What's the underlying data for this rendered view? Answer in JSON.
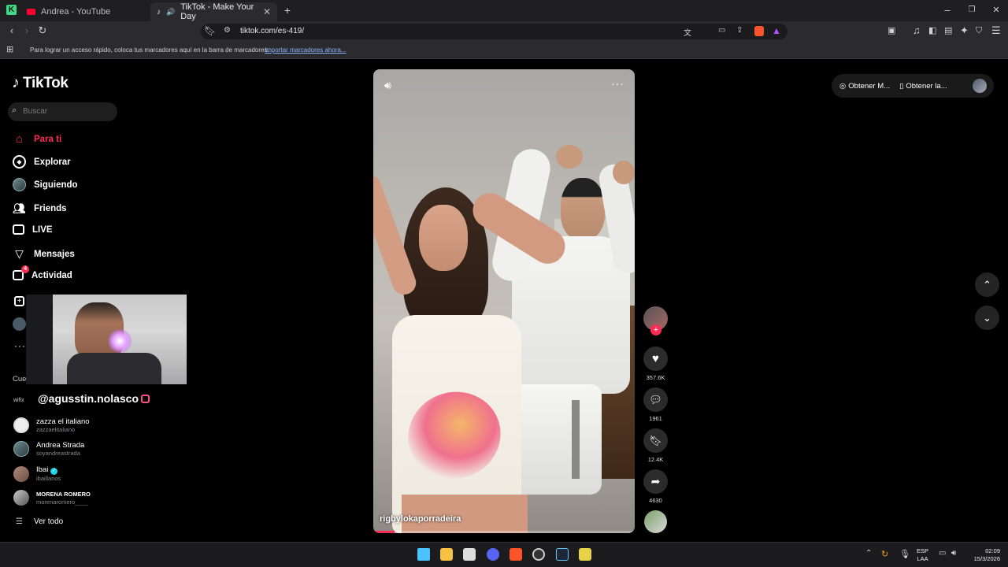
{
  "browser": {
    "tabs": [
      {
        "title": "Andrea - YouTube",
        "icon": "youtube-icon"
      },
      {
        "title": "TikTok - Make Your Day",
        "icon": "tiktok-icon",
        "active": true
      }
    ],
    "url": "tiktok.com/es-419/",
    "bookmarks_prompt": "Para lograr un acceso rápido, coloca tus marcadores aquí en la barra de marcadores.",
    "bookmarks_import": "Importar marcadores ahora...",
    "brand_color": "#ff2d55"
  },
  "sidebar": {
    "logo": "TikTok",
    "search_placeholder": "Buscar",
    "items": [
      {
        "label": "Para ti",
        "icon": "home-icon",
        "active": true
      },
      {
        "label": "Explorar",
        "icon": "compass-icon"
      },
      {
        "label": "Siguiendo",
        "icon": "avatar"
      },
      {
        "label": "Friends",
        "icon": "friends-icon"
      },
      {
        "label": "LIVE",
        "icon": "live-icon"
      },
      {
        "label": "Mensajes",
        "icon": "send-icon"
      },
      {
        "label": "Actividad",
        "icon": "activity-icon",
        "badge": "4"
      }
    ],
    "section_label": "Cue",
    "accounts": [
      {
        "name": "zazza el italiano",
        "username": "zazzaelitaliano"
      },
      {
        "name": "Andrea Strada",
        "username": "soyandreastrada"
      },
      {
        "name": "Ibai",
        "username": "ibaillanos",
        "verified": true
      },
      {
        "name": "MORENA ROMERO",
        "username": "morenaromero____"
      }
    ],
    "see_all": "Ver todo"
  },
  "overlay": {
    "streamer_handle": "@agusstin.nolasco",
    "partial_label": "wifix"
  },
  "video": {
    "author": "rigbylokaporradeira",
    "likes": "357.6K",
    "comments": "1961",
    "saves": "12.4K",
    "shares": "4630"
  },
  "top_right": {
    "button1": "Obtener M...",
    "button2": "Obtener la..."
  },
  "taskbar": {
    "lang": "ESP",
    "layout": "LAA",
    "time": "02:09",
    "date": "15/3/2026"
  }
}
